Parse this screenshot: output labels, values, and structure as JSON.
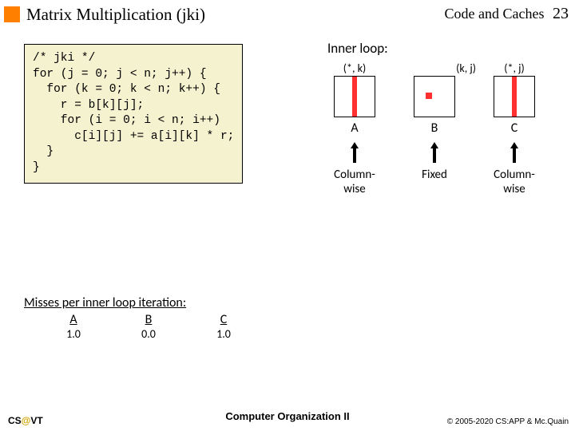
{
  "header": {
    "title": "Matrix Multiplication (jki)",
    "section": "Code and Caches",
    "page": "23"
  },
  "code": "/* jki */\nfor (j = 0; j < n; j++) {\n  for (k = 0; k < n; k++) {\n    r = b[k][j];\n    for (i = 0; i < n; i++)\n      c[i][j] += a[i][k] * r;\n  }\n}",
  "diagram": {
    "label": "Inner loop:",
    "matrices": [
      {
        "name": "A",
        "coord": "(*, k)",
        "access1": "Column-",
        "access2": "wise"
      },
      {
        "name": "B",
        "coord": "(k, j)",
        "access1": "Fixed",
        "access2": ""
      },
      {
        "name": "C",
        "coord": "(*, j)",
        "access1": "Column-",
        "access2": "wise"
      }
    ]
  },
  "misses": {
    "title": "Misses per inner loop iteration:",
    "cols": [
      "A",
      "B",
      "C"
    ],
    "vals": [
      "1.0",
      "0.0",
      "1.0"
    ]
  },
  "footer": {
    "left1": "CS",
    "at": "@",
    "left2": "VT",
    "center": "Computer Organization II",
    "right": "© 2005-2020 CS:APP & Mc.Quain"
  },
  "chart_data": {
    "type": "table",
    "title": "Misses per inner loop iteration",
    "categories": [
      "A",
      "B",
      "C"
    ],
    "values": [
      1.0,
      0.0,
      1.0
    ]
  }
}
